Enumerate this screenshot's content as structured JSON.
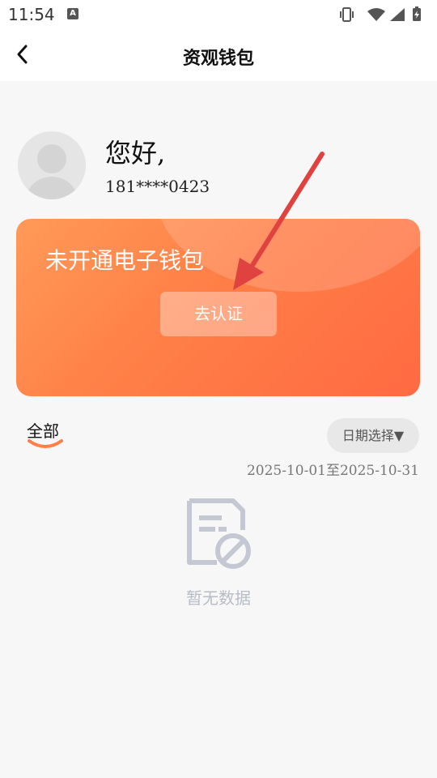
{
  "status": {
    "time": "11:54",
    "app_badge": "A"
  },
  "nav": {
    "title": "资观钱包"
  },
  "user": {
    "greeting": "您好,",
    "phone": "181****0423"
  },
  "wallet_card": {
    "title": "未开通电子钱包",
    "button_label": "去认证"
  },
  "filters": {
    "tab_all": "全部",
    "date_select_label": "日期选择▼",
    "date_range": "2025-10-01至2025-10-31"
  },
  "empty_state": {
    "text": "暂无数据"
  },
  "colors": {
    "accent": "#ff7f47",
    "arrow": "#e0433f"
  }
}
